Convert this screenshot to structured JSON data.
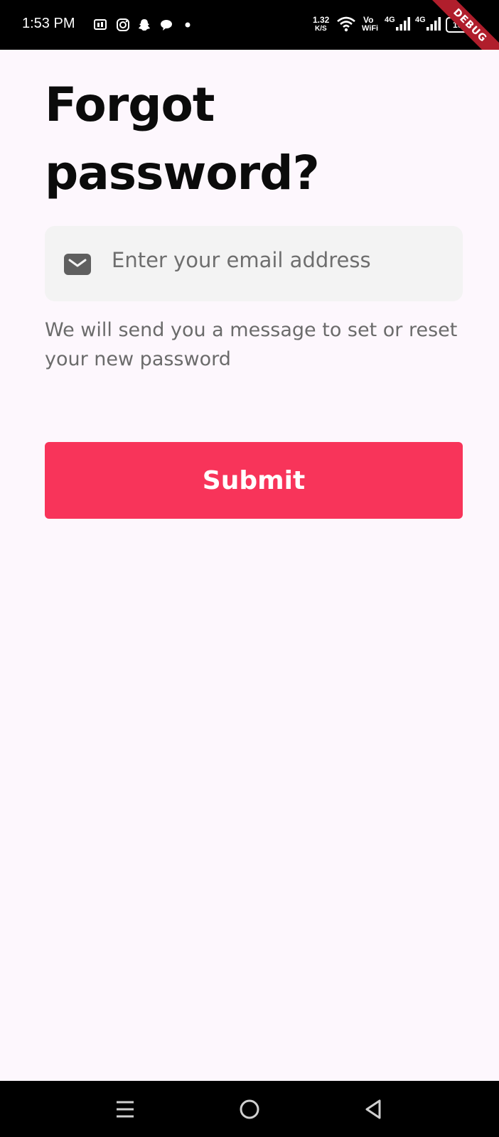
{
  "status_bar": {
    "time": "1:53 PM",
    "net_speed_value": "1.32",
    "net_speed_unit": "K/S",
    "vowifi_top": "Vo",
    "vowifi_bottom": "WiFi",
    "signal1_label": "4G",
    "signal2_label": "4G",
    "battery": "100",
    "debug_banner": "DEBUG",
    "icons": [
      "notification-icon",
      "instagram-icon",
      "snapchat-icon",
      "chat-icon",
      "dot-icon",
      "wifi-icon",
      "signal-icon",
      "battery-icon"
    ]
  },
  "forgot_password": {
    "title": "Forgot password?",
    "email_placeholder": "Enter your email address",
    "email_icon": "mail-icon",
    "help_text": "We will send you a message to set or reset your new password",
    "submit_label": "Submit"
  },
  "nav_bar": {
    "buttons": [
      "menu-icon",
      "home-icon",
      "back-icon"
    ]
  },
  "colors": {
    "background": "#fdf7fd",
    "accent": "#f8345a",
    "field_background": "#f3f3f3",
    "text_secondary": "#6b6b6b"
  }
}
